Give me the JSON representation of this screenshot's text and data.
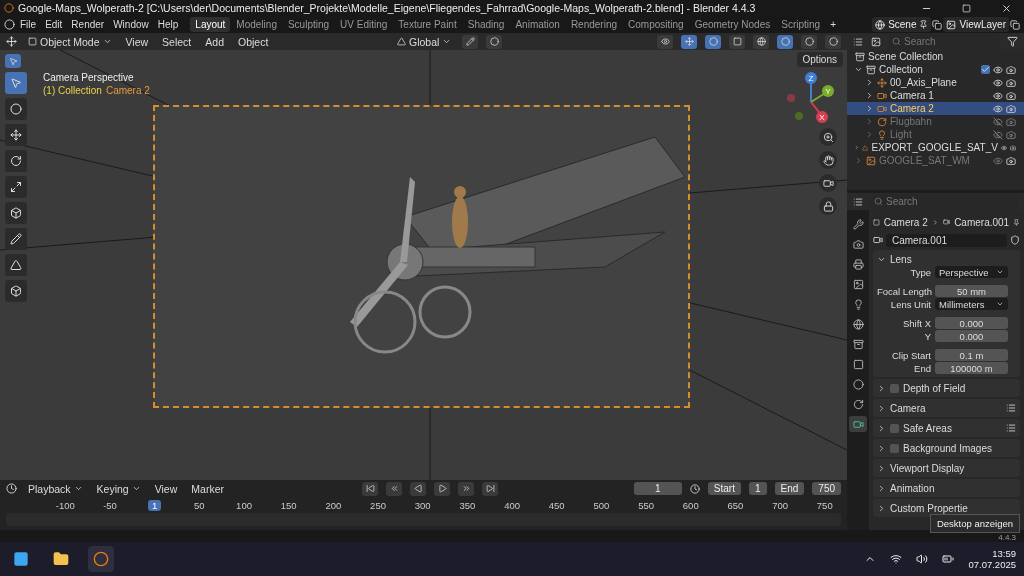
{
  "window": {
    "title": "Google-Maps_Wolperath-2 [C:\\Users\\der\\Documents\\Blender_Projekte\\Modelle_Eigene\\Fliegendes_Fahrrad\\Google-Maps_Wolperath-2.blend] - Blender 4.4.3"
  },
  "menu": [
    "File",
    "Edit",
    "Render",
    "Window",
    "Help"
  ],
  "workspaces": [
    {
      "label": "Layout",
      "selected": true
    },
    {
      "label": "Modeling",
      "selected": false
    },
    {
      "label": "Sculpting",
      "selected": false
    },
    {
      "label": "UV Editing",
      "selected": false
    },
    {
      "label": "Texture Paint",
      "selected": false
    },
    {
      "label": "Shading",
      "selected": false
    },
    {
      "label": "Animation",
      "selected": false
    },
    {
      "label": "Rendering",
      "selected": false
    },
    {
      "label": "Compositing",
      "selected": false
    },
    {
      "label": "Geometry Nodes",
      "selected": false
    },
    {
      "label": "Scripting",
      "selected": false
    }
  ],
  "add_workspace": "+",
  "scene": "Scene",
  "view_layer": "ViewLayer",
  "viewport_header": {
    "mode": "Object Mode",
    "menus": [
      "View",
      "Select",
      "Add",
      "Object"
    ],
    "orientation": "Global"
  },
  "viewport": {
    "view_name": "Camera Perspective",
    "collection": "(1) Collection",
    "active_object": "Camera 2",
    "options": "Options",
    "axes": [
      "Z",
      "Y",
      "X"
    ]
  },
  "outliner": {
    "search": {
      "placeholder": "Search"
    },
    "root": "Scene Collection",
    "items": [
      {
        "name": "Collection",
        "kind": "collection",
        "checked": true,
        "hidden": false,
        "disabled": false,
        "selected": false,
        "expanded": true,
        "children": [
          {
            "name": "00_Axis_Plane",
            "kind": "empty",
            "hidden": false,
            "disabled": false,
            "selected": false,
            "expanded": false
          },
          {
            "name": "Camera 1",
            "kind": "camera",
            "hidden": false,
            "disabled": false,
            "selected": false,
            "expanded": false
          },
          {
            "name": "Camera 2",
            "kind": "camera",
            "hidden": false,
            "disabled": false,
            "selected": true,
            "expanded": false
          },
          {
            "name": "Flugbahn",
            "kind": "curve",
            "hidden": true,
            "disabled": true,
            "selected": false,
            "expanded": false
          },
          {
            "name": "Light",
            "kind": "light",
            "hidden": true,
            "disabled": true,
            "selected": false,
            "expanded": false
          }
        ]
      },
      {
        "name": "EXPORT_GOOGLE_SAT_V",
        "kind": "mesh",
        "hidden": false,
        "disabled": false,
        "selected": false,
        "expanded": false
      },
      {
        "name": "GOOGLE_SAT_WM",
        "kind": "image",
        "hidden": false,
        "disabled": true,
        "selected": false,
        "expanded": false
      }
    ]
  },
  "properties": {
    "search": {
      "placeholder": "Search"
    },
    "tabs": [
      {
        "selected": false
      },
      {
        "selected": false
      },
      {
        "selected": false
      },
      {
        "selected": false
      },
      {
        "selected": false
      },
      {
        "selected": false
      },
      {
        "selected": false
      },
      {
        "selected": false
      },
      {
        "selected": false
      },
      {
        "selected": false
      },
      {
        "selected": true
      }
    ],
    "breadcrumb": [
      "Camera 2",
      "Camera.001"
    ],
    "datablock": "Camera.001",
    "lens": {
      "title": "Lens",
      "expanded": true,
      "fields": [
        {
          "label": "Type",
          "value": "Perspective",
          "kind": "dropdown"
        },
        {
          "label": "Focal Length",
          "value": "50 mm",
          "kind": "number"
        },
        {
          "label": "Lens Unit",
          "value": "Millimeters",
          "kind": "dropdown"
        },
        {
          "label": "Shift X",
          "value": "0.000",
          "kind": "number"
        },
        {
          "label": "Y",
          "value": "0.000",
          "kind": "number"
        },
        {
          "label": "Clip Start",
          "value": "0.1 m",
          "kind": "number"
        },
        {
          "label": "End",
          "value": "100000 m",
          "kind": "number"
        }
      ]
    },
    "panels": [
      {
        "label": "Depth of Field",
        "kind": "checkbox",
        "checked": false,
        "presets": false
      },
      {
        "label": "Camera",
        "kind": "plain",
        "presets": true
      },
      {
        "label": "Safe Areas",
        "kind": "checkbox",
        "checked": false,
        "presets": true
      },
      {
        "label": "Background Images",
        "kind": "checkbox",
        "checked": false,
        "presets": false
      },
      {
        "label": "Viewport Display",
        "kind": "plain",
        "presets": false
      },
      {
        "label": "Animation",
        "kind": "plain",
        "presets": false
      },
      {
        "label": "Custom Propertie",
        "kind": "plain",
        "presets": false
      }
    ]
  },
  "timeline": {
    "menus": [
      "Playback",
      "Keying",
      "View",
      "Marker"
    ],
    "current_frame": "1",
    "start_label": "Start",
    "start": "1",
    "end_label": "End",
    "end": "750",
    "ticks": [
      {
        "label": "-100",
        "selected": false
      },
      {
        "label": "-50",
        "selected": false
      },
      {
        "label": "1",
        "selected": true
      },
      {
        "label": "50",
        "selected": false
      },
      {
        "label": "100",
        "selected": false
      },
      {
        "label": "150",
        "selected": false
      },
      {
        "label": "200",
        "selected": false
      },
      {
        "label": "250",
        "selected": false
      },
      {
        "label": "300",
        "selected": false
      },
      {
        "label": "350",
        "selected": false
      },
      {
        "label": "400",
        "selected": false
      },
      {
        "label": "450",
        "selected": false
      },
      {
        "label": "500",
        "selected": false
      },
      {
        "label": "550",
        "selected": false
      },
      {
        "label": "600",
        "selected": false
      },
      {
        "label": "650",
        "selected": false
      },
      {
        "label": "700",
        "selected": false
      },
      {
        "label": "750",
        "selected": false
      }
    ]
  },
  "status_bar": {
    "version": "4.4.3",
    "tooltip": "Desktop anzeigen"
  },
  "taskbar": {
    "time": "13:59",
    "date": "07.07.2025"
  }
}
